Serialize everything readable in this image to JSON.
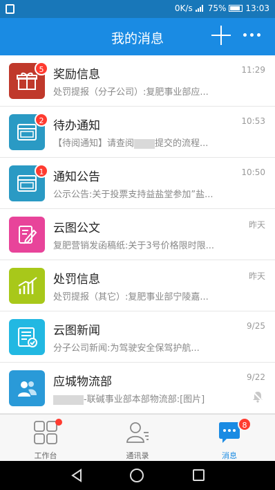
{
  "status": {
    "speed": "0K/s",
    "battery": "75%",
    "time": "13:03"
  },
  "header": {
    "title": "我的消息"
  },
  "messages": [
    {
      "name": "奖励信息",
      "time": "11:29",
      "preview": "处罚提报（分子公司）:复肥事业部应...",
      "badge": "5",
      "icon": "gift-icon",
      "color": "#c0392b"
    },
    {
      "name": "待办通知",
      "time": "10:53",
      "preview_a": "【待阅通知】请查阅",
      "preview_b": "提交的流程...",
      "badge": "2",
      "icon": "browser-window-icon",
      "color": "#2a9ac4"
    },
    {
      "name": "通知公告",
      "time": "10:50",
      "preview": "公示公告:关于投票支持益盐堂参加”盐...",
      "badge": "1",
      "icon": "browser-window-icon",
      "color": "#2a9ac4"
    },
    {
      "name": "云图公文",
      "time": "昨天",
      "preview": "复肥营销发函稿纸:关于3号价格限时限...",
      "icon": "document-edit-icon",
      "color": "#e8449a"
    },
    {
      "name": "处罚信息",
      "time": "昨天",
      "preview": "处罚提报（其它）:复肥事业部宁陵嘉...",
      "icon": "chart-icon",
      "color": "#a8c81a"
    },
    {
      "name": "云图新闻",
      "time": "9/25",
      "preview": "分子公司新闻:为驾驶安全保驾护航...",
      "icon": "news-icon",
      "color": "#22b8e2"
    },
    {
      "name": "应城物流部",
      "time": "9/22",
      "preview_b": "-联碱事业部本部物流部:[图片]",
      "icon": "group-icon",
      "color": "#2a9ad8",
      "muted": true
    }
  ],
  "tabs": [
    {
      "label": "工作台",
      "icon": "grid-apps-icon"
    },
    {
      "label": "通讯录",
      "icon": "contacts-icon"
    },
    {
      "label": "消息",
      "icon": "chat-bubble-icon",
      "badge": "8"
    }
  ]
}
